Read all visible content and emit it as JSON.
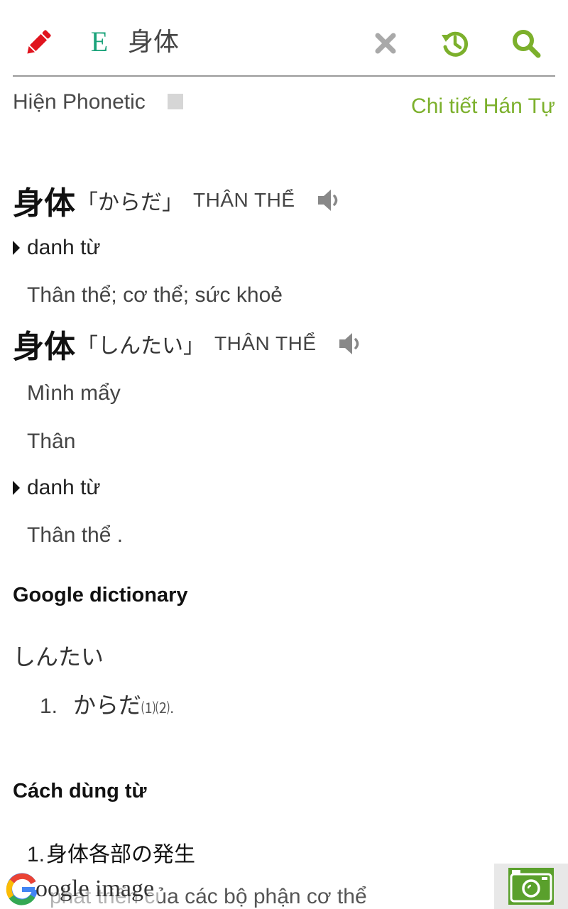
{
  "header": {
    "query": "身体",
    "lang_badge": "E",
    "edit_icon": "pencil-icon",
    "clear_icon": "close-icon",
    "history_icon": "history-icon",
    "search_icon": "search-icon"
  },
  "options": {
    "phonetic_label": "Hiện Phonetic",
    "phonetic_checked": false,
    "kanji_detail_link": "Chi tiết Hán Tự"
  },
  "entries": [
    {
      "word": "身体",
      "reading": "「からだ」",
      "hanviet": "THÂN THỂ",
      "groups": [
        {
          "pos": "danh từ",
          "meanings": [
            "Thân thể; cơ thể; sức khoẻ"
          ]
        }
      ]
    },
    {
      "word": "身体",
      "reading": "「しんたい」",
      "hanviet": "THÂN THỂ",
      "meanings_top": [
        "Mình mẩy",
        "Thân"
      ],
      "groups": [
        {
          "pos": "danh từ",
          "meanings": [
            "Thân thể ."
          ]
        }
      ]
    }
  ],
  "google_dictionary": {
    "title": "Google dictionary",
    "reading": "しんたい",
    "definitions": [
      {
        "num": "1.",
        "text": "からだ",
        "refs": "⑴⑵."
      }
    ]
  },
  "usage": {
    "title": "Cách dùng từ",
    "examples": [
      {
        "num": "1.",
        "jp": "身体各部の発生",
        "vi": "phát triển của các bộ phận cơ thể"
      }
    ]
  },
  "footer": {
    "google_image_label": "oogle image",
    "camera_icon": "camera-icon"
  },
  "colors": {
    "accent_green": "#7cb02c",
    "badge_green": "#1aa37a",
    "edit_red": "#e0141e",
    "clear_gray": "#a9a9a9"
  }
}
